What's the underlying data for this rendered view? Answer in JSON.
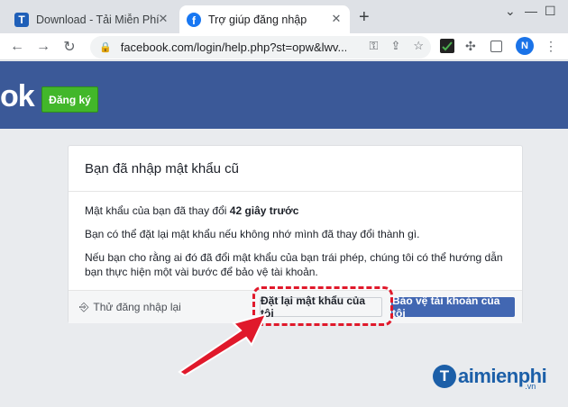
{
  "browser": {
    "tabs": [
      {
        "title": "Download - Tải Miễn Phí VI",
        "icon": "taimienphi-favicon"
      },
      {
        "title": "Trợ giúp đăng nhập",
        "icon": "facebook-favicon"
      }
    ],
    "url": "facebook.com/login/help.php?st=opw&lwv...",
    "profile_initial": "N",
    "window_controls": {
      "minimize": "—",
      "maximize": "☐",
      "close": "✕"
    }
  },
  "header": {
    "logo_text": "ok",
    "signup_label": "Đăng ký"
  },
  "card": {
    "title": "Bạn đã nhập mật khẩu cũ",
    "line1_prefix": "Mật khẩu của bạn đã thay đổi ",
    "line1_bold": "42 giây trước",
    "line2": "Bạn có thể đặt lại mật khẩu nếu không nhớ mình đã thay đổi thành gì.",
    "line3": "Nếu bạn cho rằng ai đó đã đổi mật khẩu của bạn trái phép, chúng tôi có thể hướng dẫn bạn thực hiện một vài bước để bảo vệ tài khoản.",
    "retry_label": "Thử đăng nhập lại",
    "reset_label": "Đặt lại mật khẩu của tôi",
    "secure_label": "Bảo vệ tài khoản của tôi"
  },
  "watermark": {
    "letter": "T",
    "text": "aimienphi",
    "suffix": ".vn"
  },
  "colors": {
    "facebook_blue": "#3b5998",
    "signup_green": "#42b72a",
    "secure_button": "#4267b2",
    "highlight_red": "#e0192b"
  }
}
